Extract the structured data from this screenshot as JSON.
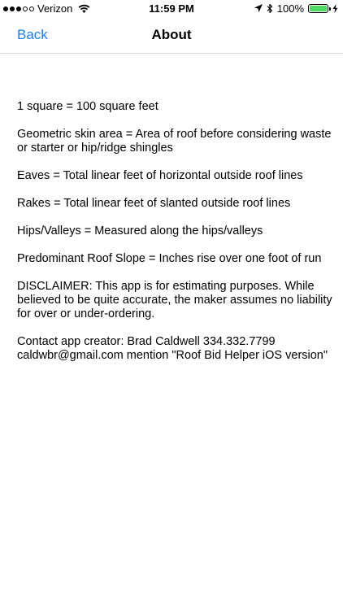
{
  "status_bar": {
    "carrier": "Verizon",
    "time": "11:59 PM",
    "battery": "100%",
    "battery_level": 1.0,
    "battery_color": "#4cd964"
  },
  "nav": {
    "back_label": "Back",
    "title": "About",
    "accent_color": "#1a7ff0"
  },
  "content": {
    "paragraphs": [
      "1 square = 100 square feet",
      "Geometric skin area = Area of roof before considering waste or starter or hip/ridge shingles",
      "Eaves = Total linear feet of horizontal outside roof lines",
      "Rakes = Total linear feet of slanted outside roof lines",
      "Hips/Valleys = Measured along the hips/valleys",
      "Predominant Roof Slope = Inches rise over one foot of run",
      "DISCLAIMER: This app is for estimating purposes. While believed to be quite accurate, the maker assumes no liability for over or under-ordering.",
      "Contact app creator: Brad Caldwell 334.332.7799 caldwbr@gmail.com mention \"Roof Bid Helper iOS version\""
    ]
  }
}
